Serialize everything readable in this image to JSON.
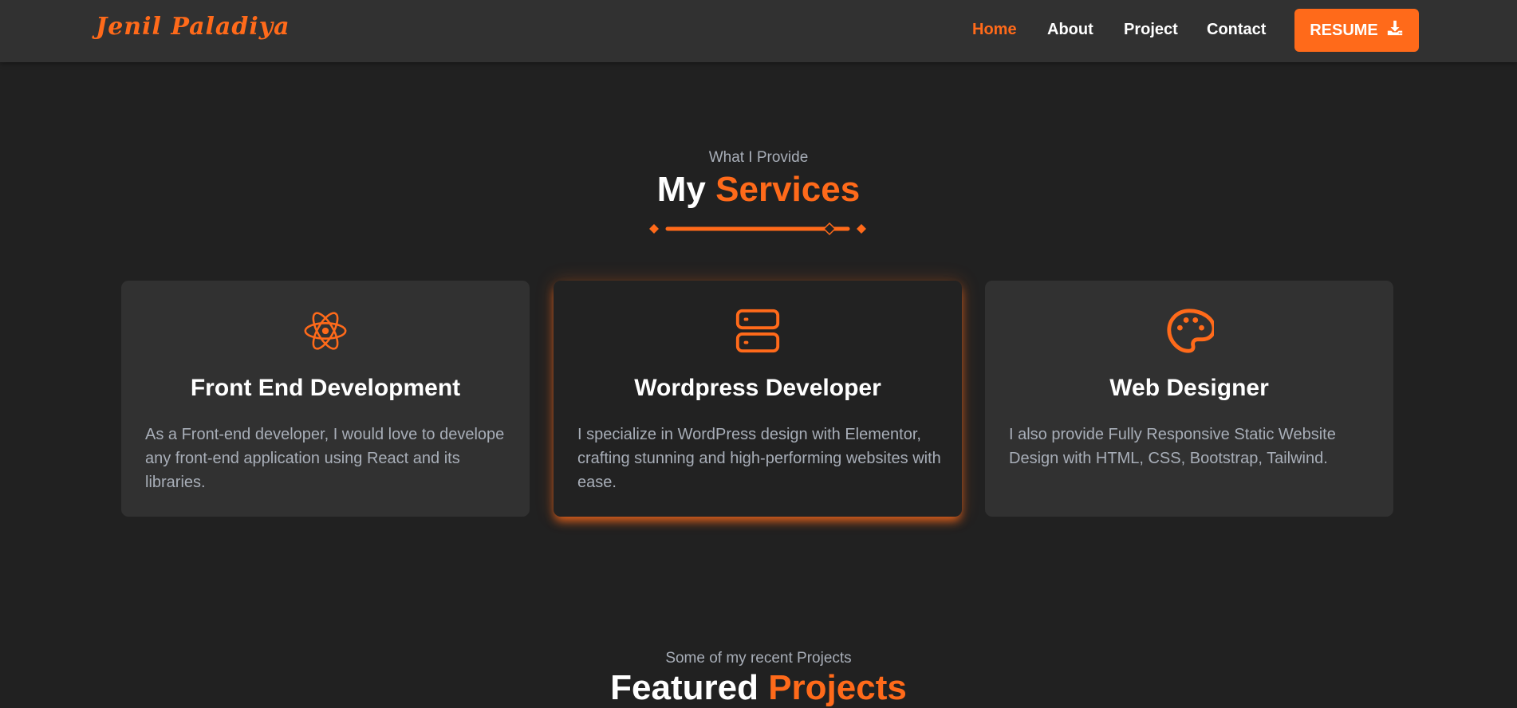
{
  "brand": {
    "name": "Jenil Paladiya"
  },
  "nav": {
    "home": "Home",
    "about": "About",
    "project": "Project",
    "contact": "Contact",
    "resume": "RESUME"
  },
  "services": {
    "subtitle": "What I Provide",
    "title_main": "My",
    "title_accent": "Services",
    "cards": [
      {
        "icon": "atom-icon",
        "title": "Front End Development",
        "description": "As a Front-end developer, I would love to develope any front-end application using React and its libraries."
      },
      {
        "icon": "server-icon",
        "title": "Wordpress Developer",
        "description": "I specialize in WordPress design with Elementor, crafting stunning and high-performing websites with ease."
      },
      {
        "icon": "palette-icon",
        "title": "Web Designer",
        "description": "I also provide Fully Responsive Static Website Design with HTML, CSS, Bootstrap, Tailwind."
      }
    ]
  },
  "projects": {
    "subtitle": "Some of my recent Projects",
    "title_main": "Featured",
    "title_accent": "Projects"
  },
  "colors": {
    "accent": "#ff6a1a",
    "background": "#212121",
    "card": "#313131",
    "muted_text": "#a8aeb8"
  }
}
